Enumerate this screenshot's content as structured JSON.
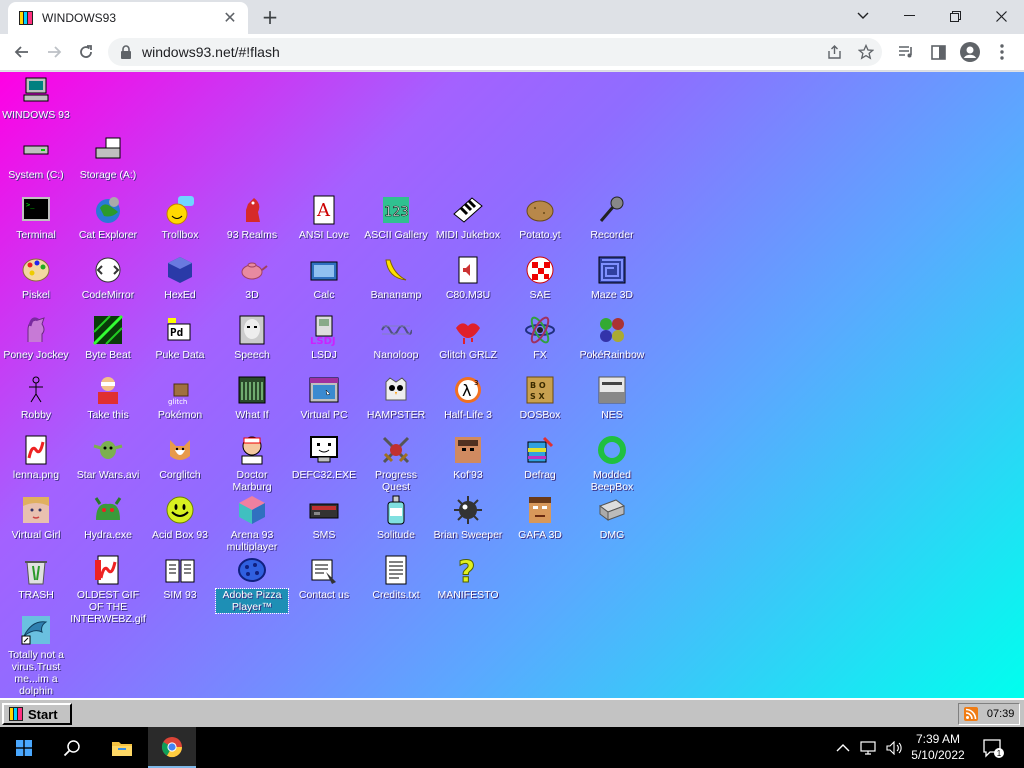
{
  "browser": {
    "tab_title": "WINDOWS93",
    "url": "windows93.net/#!flash"
  },
  "desktop": {
    "selected_icon": "Adobe Pizza Player™",
    "icons": [
      {
        "label": "WINDOWS 93",
        "icon": "computer-icon"
      },
      {
        "label": "System (C:)",
        "icon": "drive-icon"
      },
      {
        "label": "Storage (A:)",
        "icon": "floppy-drive-icon"
      },
      {
        "label": "Terminal",
        "icon": "terminal-icon"
      },
      {
        "label": "Cat Explorer",
        "icon": "cat-globe-icon"
      },
      {
        "label": "Trollbox",
        "icon": "chat-smiley-icon"
      },
      {
        "label": "93 Realms",
        "icon": "knight-icon"
      },
      {
        "label": "ANSI Love",
        "icon": "letter-a-icon"
      },
      {
        "label": "ASCII Gallery",
        "icon": "numbers-icon"
      },
      {
        "label": "MIDI Jukebox",
        "icon": "piano-icon"
      },
      {
        "label": "Potato.yt",
        "icon": "potato-icon"
      },
      {
        "label": "Recorder",
        "icon": "microphone-icon"
      },
      {
        "label": "Piskel",
        "icon": "palette-icon"
      },
      {
        "label": "CodeMirror",
        "icon": "code-icon"
      },
      {
        "label": "HexEd",
        "icon": "cube-icon"
      },
      {
        "label": "3D",
        "icon": "teapot-icon"
      },
      {
        "label": "Calc",
        "icon": "calculator-icon"
      },
      {
        "label": "Bananamp",
        "icon": "banana-icon"
      },
      {
        "label": "C80.M3U",
        "icon": "audio-file-icon"
      },
      {
        "label": "SAE",
        "icon": "checker-ball-icon"
      },
      {
        "label": "Maze 3D",
        "icon": "maze-icon"
      },
      {
        "label": "Poney Jockey",
        "icon": "pony-icon"
      },
      {
        "label": "Byte Beat",
        "icon": "bytebeat-icon"
      },
      {
        "label": "Puke Data",
        "icon": "pd-icon"
      },
      {
        "label": "Speech",
        "icon": "face-icon"
      },
      {
        "label": "LSDJ",
        "icon": "gameboy-icon"
      },
      {
        "label": "Nanoloop",
        "icon": "wave-icon"
      },
      {
        "label": "Glitch GRLZ",
        "icon": "lips-icon"
      },
      {
        "label": "FX",
        "icon": "atom-icon"
      },
      {
        "label": "PokéRainbow",
        "icon": "pokemon-icon"
      },
      {
        "label": "Robby",
        "icon": "stickman-icon"
      },
      {
        "label": "Take this",
        "icon": "take-this-icon"
      },
      {
        "label": "Pokémon",
        "icon": "pokemon-glitch-icon"
      },
      {
        "label": "What If",
        "icon": "what-if-icon"
      },
      {
        "label": "Virtual PC",
        "icon": "window-icon"
      },
      {
        "label": "HAMPSTER",
        "icon": "owl-icon"
      },
      {
        "label": "Half-Life 3",
        "icon": "half-life-icon"
      },
      {
        "label": "DOSBox",
        "icon": "dosbox-icon"
      },
      {
        "label": "NES",
        "icon": "nes-icon"
      },
      {
        "label": "lenna.png",
        "icon": "image-file-icon"
      },
      {
        "label": "Star Wars.avi",
        "icon": "yoda-icon"
      },
      {
        "label": "Corglitch",
        "icon": "corgi-icon"
      },
      {
        "label": "Doctor Marburg",
        "icon": "doctor-icon"
      },
      {
        "label": "DEFC32.EXE",
        "icon": "monitor-face-icon"
      },
      {
        "label": "Progress Quest",
        "icon": "crossed-swords-icon"
      },
      {
        "label": "Kof'93",
        "icon": "fighter-icon"
      },
      {
        "label": "Defrag",
        "icon": "defrag-icon"
      },
      {
        "label": "Modded BeepBox",
        "icon": "ring-icon"
      },
      {
        "label": "Virtual Girl",
        "icon": "girl-icon"
      },
      {
        "label": "Hydra.exe",
        "icon": "hydra-icon"
      },
      {
        "label": "Acid Box 93",
        "icon": "acid-smiley-icon"
      },
      {
        "label": "Arena 93 multiplayer",
        "icon": "arena-cube-icon"
      },
      {
        "label": "SMS",
        "icon": "console-icon"
      },
      {
        "label": "Solitude",
        "icon": "bottle-icon"
      },
      {
        "label": "Brian Sweeper",
        "icon": "mine-icon"
      },
      {
        "label": "GAFA 3D",
        "icon": "doom-face-icon"
      },
      {
        "label": "DMG",
        "icon": "dmg-icon"
      },
      {
        "label": "TRASH",
        "icon": "trash-icon"
      },
      {
        "label": "OLDEST GIF OF THE INTERWEBZ.gif",
        "icon": "gif-file-icon"
      },
      {
        "label": "SIM 93",
        "icon": "book-icon"
      },
      {
        "label": "Adobe Pizza Player™",
        "icon": "pizza-icon"
      },
      {
        "label": "Contact us",
        "icon": "mail-icon"
      },
      {
        "label": "Credits.txt",
        "icon": "text-file-icon"
      },
      {
        "label": "MANIFESTO",
        "icon": "question-mark-icon"
      },
      {
        "label": "Totally not a virus.Trust me...im a dolphin",
        "icon": "dolphin-icon"
      }
    ]
  },
  "w93taskbar": {
    "start_label": "Start",
    "clock": "07:39"
  },
  "windows_taskbar": {
    "time": "7:39 AM",
    "date": "5/10/2022",
    "notification_count": "1"
  },
  "colors": {
    "desktop_gradient_start": "#ff00e4",
    "desktop_gradient_end": "#00ffee",
    "selected_label_bg": "#1e8fb5"
  }
}
